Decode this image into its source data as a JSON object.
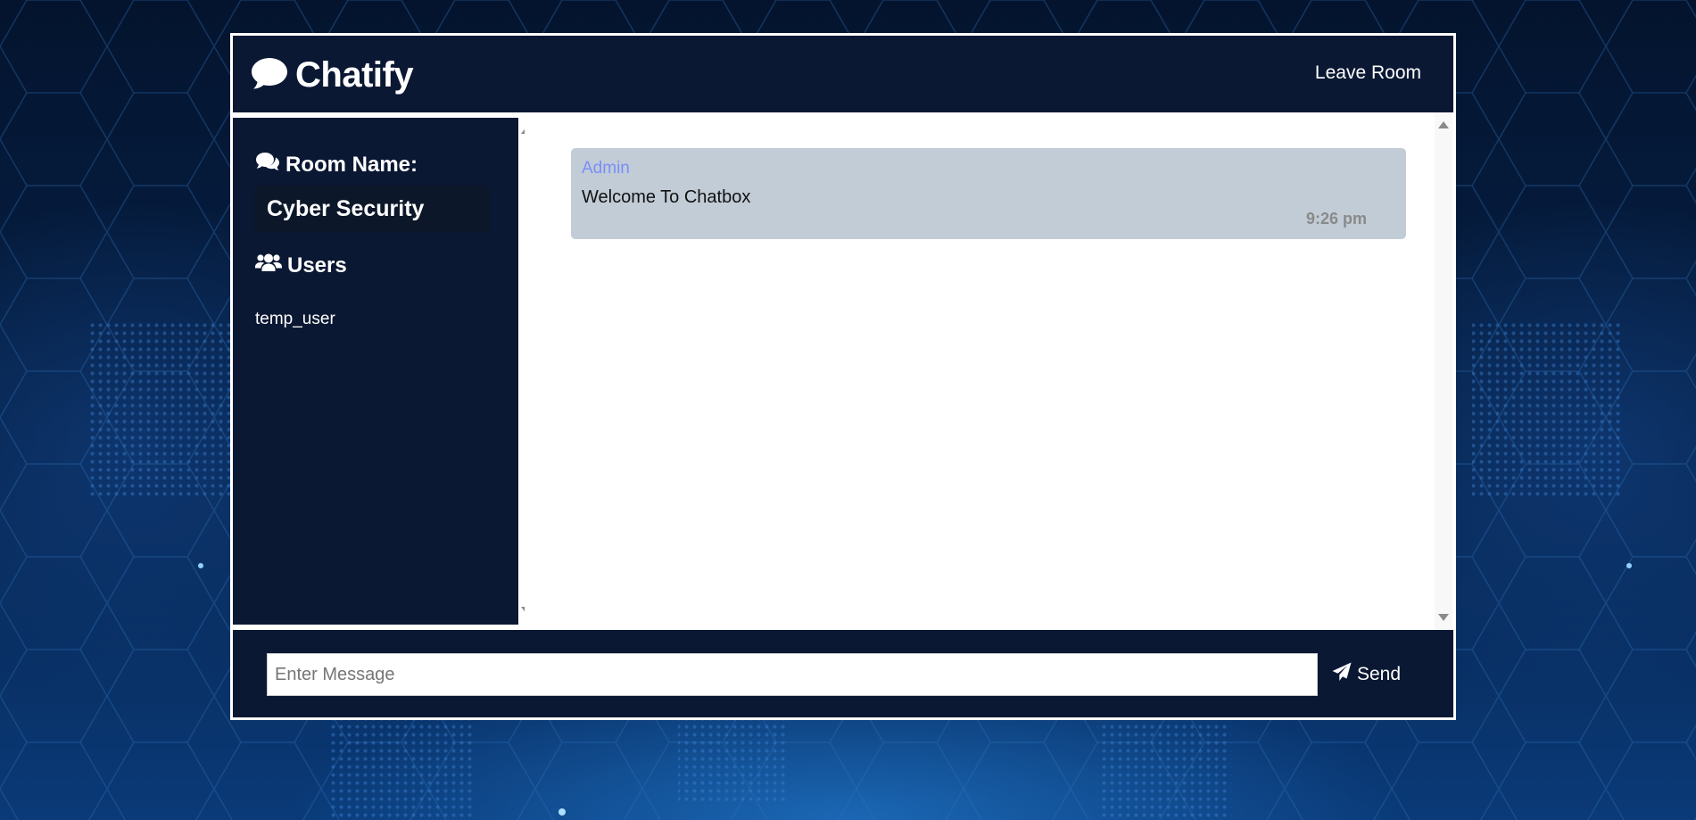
{
  "header": {
    "logo_icon": "comment-icon",
    "title": "Chatify",
    "leave_label": "Leave Room"
  },
  "sidebar": {
    "room_heading_icon": "comments-icon",
    "room_heading": "Room Name:",
    "room_name": "Cyber Security",
    "users_heading_icon": "users-icon",
    "users_heading": "Users",
    "users": [
      "temp_user"
    ]
  },
  "messages": [
    {
      "author": "Admin",
      "text": "Welcome To Chatbox",
      "time": "9:26 pm"
    }
  ],
  "form": {
    "placeholder": "Enter Message",
    "value": "",
    "send_icon": "paper-plane-icon",
    "send_label": "Send"
  },
  "colors": {
    "panel": "#0b1833",
    "message_bg": "#c1ccd6",
    "author": "#7b8ef8",
    "time": "#8a8a8a"
  }
}
